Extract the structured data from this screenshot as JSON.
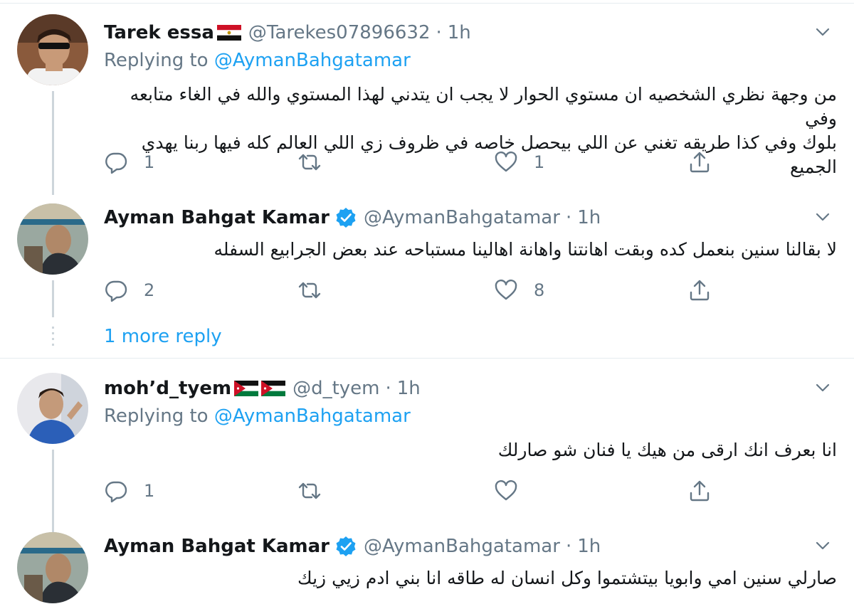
{
  "tweets": [
    {
      "name": "Tarek essa",
      "handle": "@Tarekes07896632",
      "separator": "·",
      "time": "1h",
      "replying_prefix": "Replying to",
      "replying_to": "@AymanBahgatamar",
      "text_lines": [
        "من وجهة نظري الشخصيه ان مستوي الحوار لا يجب ان يتدني لهذا المستوي والله في الغاء متابعه وفي",
        "بلوك وفي كذا طريقه تغني عن اللي بيحصل خاصه في ظروف زي اللي العالم كله فيها ربنا يهدي الجميع"
      ],
      "reply_count": "1",
      "retweet_count": "",
      "like_count": "1",
      "flag_icon": "egypt-flag-icon"
    },
    {
      "name": "Ayman Bahgat Kamar",
      "handle": "@AymanBahgatamar",
      "separator": "·",
      "time": "1h",
      "verified": true,
      "text_lines": [
        "لا بقالنا سنين بنعمل كده وبقت اهانتنا واهانة اهالينا مستباحه عند بعض الجرابيع السفله"
      ],
      "reply_count": "2",
      "retweet_count": "",
      "like_count": "8"
    },
    {
      "name": "moh’d_tyem",
      "handle": "@d_tyem",
      "separator": "·",
      "time": "1h",
      "replying_prefix": "Replying to",
      "replying_to": "@AymanBahgatamar",
      "text_lines": [
        "انا بعرف انك ارقى من هيك يا فنان شو صارلك"
      ],
      "reply_count": "1",
      "retweet_count": "",
      "like_count": "",
      "flag_icon": "jordan-flag-icon"
    },
    {
      "name": "Ayman Bahgat Kamar",
      "handle": "@AymanBahgatamar",
      "separator": "·",
      "time": "1h",
      "verified": true,
      "text_lines": [
        "صارلي سنين امي وابويا بيتشتموا وكل انسان له طاقه انا بني ادم زيي زيك"
      ]
    }
  ],
  "more_reply": "1 more reply",
  "colors": {
    "link_blue": "#1da1f2",
    "secondary_text": "#657786",
    "primary_text": "#14171a",
    "thread_line": "#cdd5db",
    "divider": "#e6ecf0"
  }
}
